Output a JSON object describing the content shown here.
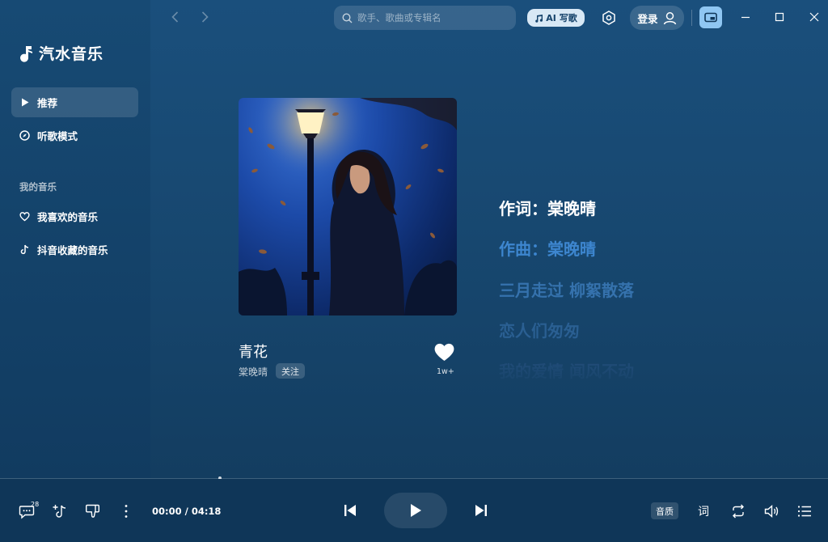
{
  "app": {
    "logo_text": "汽水音乐"
  },
  "sidebar": {
    "items": [
      {
        "label": "推荐",
        "icon": "play-triangle-icon"
      },
      {
        "label": "听歌模式",
        "icon": "compass-icon"
      }
    ],
    "section_label": "我的音乐",
    "my_music": [
      {
        "label": "我喜欢的音乐",
        "icon": "heart-outline-icon"
      },
      {
        "label": "抖音收藏的音乐",
        "icon": "tiktok-icon"
      }
    ]
  },
  "topbar": {
    "search_placeholder": "歌手、歌曲或专辑名",
    "ai_label": "AI 写歌",
    "login_label": "登录"
  },
  "song": {
    "title": "青花",
    "artist": "棠晚晴",
    "follow_label": "关注",
    "like_count": "1w+"
  },
  "lyrics": [
    {
      "text": "作词：棠晚晴",
      "color": "#ffffff"
    },
    {
      "text": "作曲：棠晚晴",
      "color": "#3d86cf"
    },
    {
      "text": "三月走过 柳絮散落",
      "color": "#3572ad"
    },
    {
      "text": "恋人们匆匆",
      "color": "#2a5f92"
    },
    {
      "text": "我的爱情 闻风不动",
      "color": "#244f7c"
    }
  ],
  "player": {
    "comment_count": "28",
    "time": "00:00 / 04:18",
    "progress": 0.0,
    "quality_label": "音质",
    "lyric_label": "词"
  }
}
